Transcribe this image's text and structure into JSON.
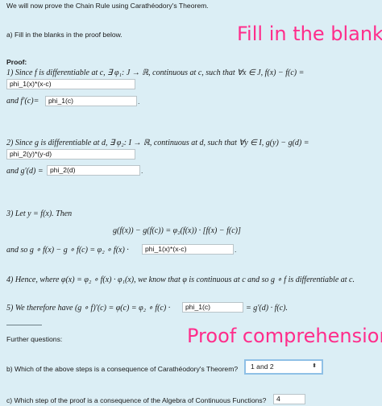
{
  "intro": "We will now prove the Chain Rule using Carathéodory's Theorem.",
  "part_a": "a) Fill in the blanks in the proof below.",
  "annotations": {
    "fill": "Fill in the blanks",
    "proof": "Proof comprehension"
  },
  "proof_label": "Proof:",
  "step1": {
    "text": "1) Since f is differentiable at c, ∃ φ₁: J → ℝ, continuous at c, such that ∀x ∈ J,  f(x) − f(c) =",
    "input1": "phi_1(x)*(x-c)",
    "and_label": "and f′(c)=",
    "input2": "phi_1(c)",
    "dot": "."
  },
  "step2": {
    "text": "2) Since g is differentiable at d, ∃ φ₂: I → ℝ, continuous at d, such that ∀y ∈ I,  g(y) − g(d) =",
    "input1": "phi_2(y)*(y-d)",
    "and_label": "and g′(d) =",
    "input2": "phi_2(d)",
    "dot": "."
  },
  "step3": {
    "text": "3) Let y = f(x). Then",
    "equation": "g(f(x)) − g(f(c)) = φ₂(f(x)) · [f(x) − f(c)]",
    "and_label": "and so g ∘ f(x) − g ∘ f(c) = φ₂ ∘ f(x) ·",
    "input": "phi_1(x)*(x-c)",
    "dot": "."
  },
  "step4": {
    "text": "4) Hence, where φ(x) = φ₂ ∘ f(x) · φ₁(x), we know that φ is continuous at c and so g ∘ f is differentiable at c."
  },
  "step5": {
    "text": "5) We therefore have (g ∘ f)′(c) = φ(c) = φ₂ ∘ f(c) ·",
    "input": "phi_1(c)",
    "tail": "= g′(d) · f(c)."
  },
  "further": "Further questions:",
  "qb": {
    "text": "b) Which of the above steps is a consequence of Carathéodory's Theorem?",
    "selected": "1 and 2"
  },
  "qc": {
    "text": "c) Which step of the proof is a consequence of the Algebra of Continuous Functions?",
    "value": "4"
  },
  "icons": {
    "chevron": "chevron-updown-icon"
  }
}
